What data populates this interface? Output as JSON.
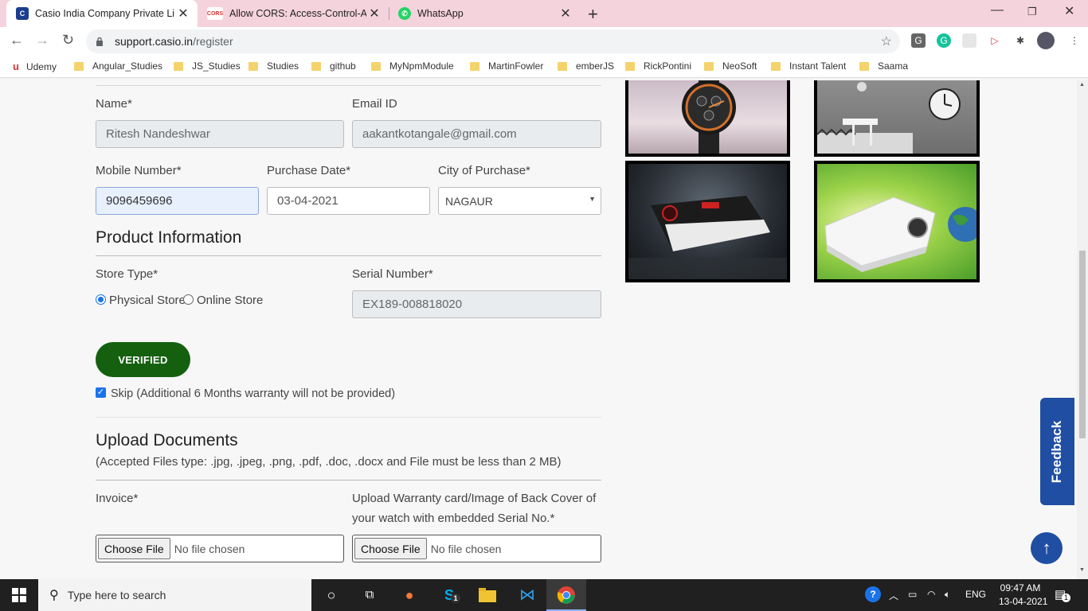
{
  "browser": {
    "tabs": [
      {
        "title": "Casio India Company Private Lim",
        "active": true
      },
      {
        "title": "Allow CORS: Access-Control-Allo",
        "active": false
      },
      {
        "title": "WhatsApp",
        "active": false
      }
    ],
    "favicons": {
      "casio": "C",
      "cors": "CORS"
    },
    "url_host": "support.casio.in",
    "url_path": "/register",
    "bookmarks": [
      "Udemy",
      "Angular_Studies",
      "JS_Studies",
      "Studies",
      "github",
      "MyNpmModule",
      "MartinFowler",
      "emberJS",
      "RickPontini",
      "NeoSoft",
      "Instant Talent",
      "Saama"
    ]
  },
  "form": {
    "name_label": "Name*",
    "name_value": "Ritesh Nandeshwar",
    "email_label": "Email ID",
    "email_value": "aakantkotangale@gmail.com",
    "mobile_label": "Mobile Number*",
    "mobile_value": "9096459696",
    "purchase_date_label": "Purchase Date*",
    "purchase_date_value": "03-04-2021",
    "city_label": "City of Purchase*",
    "city_value": "NAGAUR",
    "product_section_title": "Product Information",
    "store_type_label": "Store Type*",
    "store_physical": "Physical Store",
    "store_online": "Online Store",
    "store_selected": "Physical Store",
    "serial_label": "Serial Number*",
    "serial_value": "EX189-008818020",
    "verified_button": "VERIFIED",
    "skip_label": "Skip (Additional 6 Months warranty will not be provided)",
    "skip_checked": true,
    "upload_section_title": "Upload Documents",
    "upload_note": "(Accepted Files type: .jpg, .jpeg, .png, .pdf, .doc, .docx and File must be less than 2 MB)",
    "invoice_label": "Invoice*",
    "warranty_label_line1": "Upload Warranty card/Image of Back Cover of",
    "warranty_label_line2": "your watch with embedded Serial No.*",
    "choose_file": "Choose File",
    "no_file": "No file chosen"
  },
  "sidebar": {
    "feedback_label": "Feedback",
    "scroll_top_icon": "arrow-up-icon"
  },
  "taskbar": {
    "search_placeholder": "Type here to search",
    "language": "ENG",
    "time": "09:47 AM",
    "date": "13-04-2021",
    "notification_count": "1",
    "skype_badge": "1"
  },
  "colors": {
    "accent_blue": "#1f4ea3",
    "verified_green": "#14600f",
    "tabstrip_pink": "#f5d3dd"
  }
}
